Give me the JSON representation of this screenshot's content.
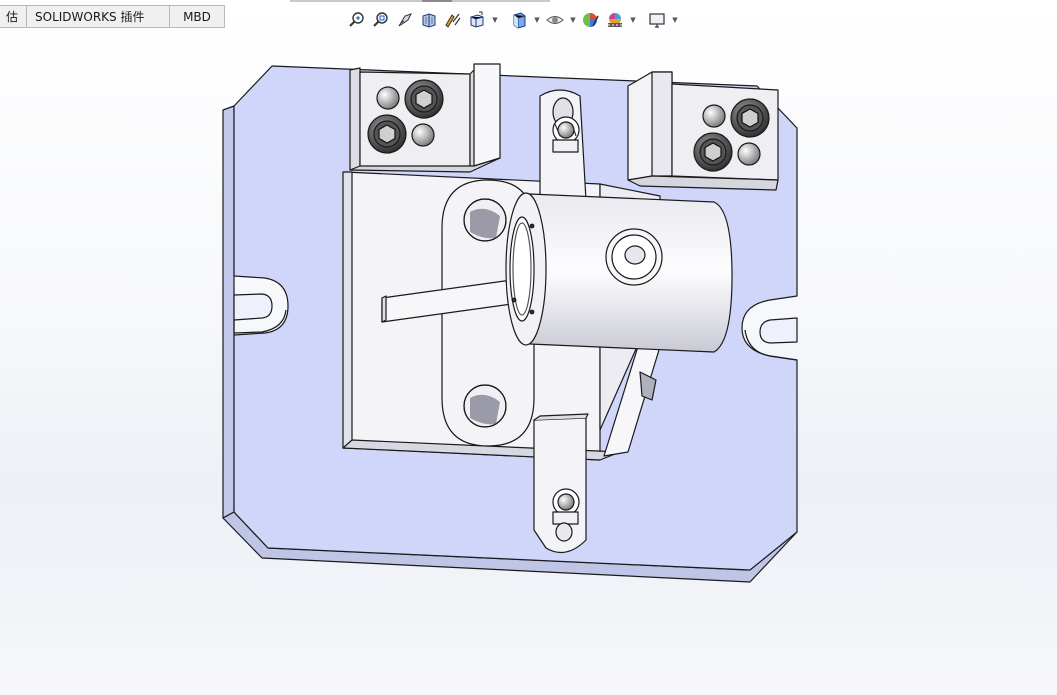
{
  "command_tabs": {
    "partial_tab": "估",
    "addins_tab": "SOLIDWORKS 插件",
    "mbd_tab": "MBD"
  },
  "view_toolbar": {
    "icons": [
      "zoom-to-fit-icon",
      "zoom-to-area-icon",
      "previous-view-icon",
      "section-view-icon",
      "dynamic-annotation-icon",
      "view-orientation-icon",
      "display-style-icon",
      "hide-show-items-icon",
      "edit-appearance-icon",
      "apply-scene-icon",
      "view-settings-icon"
    ]
  },
  "model": {
    "plate_color": "#d0d6fa",
    "part_color": "#f2f2f6",
    "edge_color": "#1a1a1a"
  }
}
